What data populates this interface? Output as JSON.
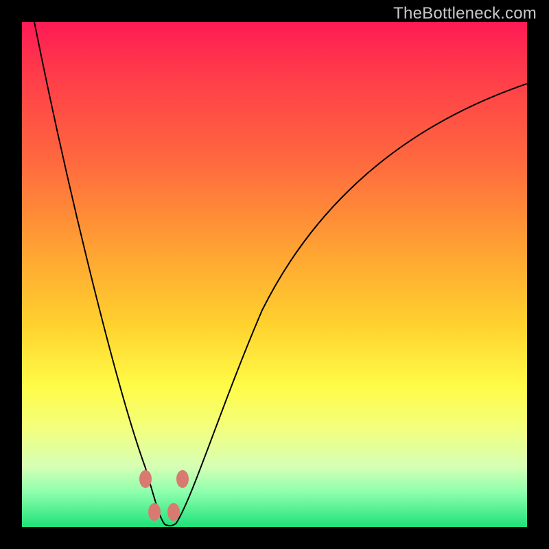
{
  "watermark": "TheBottleneck.com",
  "colors": {
    "gradient_stops": [
      "#ff1a55",
      "#ff3b4a",
      "#ff6a3e",
      "#ffa233",
      "#ffd22e",
      "#fffb47",
      "#f4ff7a",
      "#d6ffb5",
      "#8fffad",
      "#1fe27a"
    ],
    "node_fill": "#d87a70",
    "curve_stroke": "#000000",
    "frame": "#000000"
  },
  "chart_data": {
    "type": "line",
    "title": "",
    "xlabel": "",
    "ylabel": "",
    "xlim": [
      0,
      1
    ],
    "ylim": [
      0,
      1
    ],
    "series": [
      {
        "name": "left-branch",
        "x": [
          0.025,
          0.1,
          0.17,
          0.22,
          0.25,
          0.265,
          0.28
        ],
        "values": [
          1.0,
          0.6,
          0.3,
          0.12,
          0.04,
          0.01,
          0.0
        ]
      },
      {
        "name": "right-branch",
        "x": [
          0.28,
          0.3,
          0.33,
          0.38,
          0.45,
          0.55,
          0.7,
          0.85,
          1.0
        ],
        "values": [
          0.0,
          0.03,
          0.1,
          0.25,
          0.42,
          0.58,
          0.73,
          0.82,
          0.88
        ]
      }
    ],
    "markers": [
      {
        "name": "node-left-upper",
        "x": 0.245,
        "y": 0.095
      },
      {
        "name": "node-left-lower",
        "x": 0.262,
        "y": 0.03
      },
      {
        "name": "node-right-lower",
        "x": 0.3,
        "y": 0.03
      },
      {
        "name": "node-right-upper",
        "x": 0.318,
        "y": 0.095
      }
    ]
  }
}
